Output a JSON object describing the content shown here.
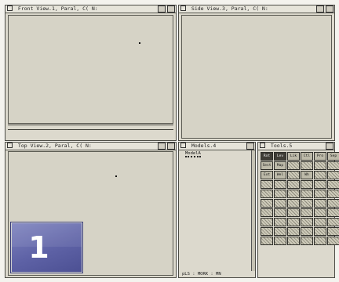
{
  "windows": {
    "front": {
      "title": "Front View.1, Paral, C( N:"
    },
    "side": {
      "title": "Side View.3, Paral, C( N:"
    },
    "top": {
      "title": "Top View.2, Paral, C( N:"
    },
    "models": {
      "title": "Models.4",
      "item": "ModelA"
    },
    "tools": {
      "title": "Tools.5"
    }
  },
  "toolbox": {
    "rows": [
      [
        "Rot",
        "Lev",
        "Lik",
        "Ctl",
        "Pro",
        "Sep"
      ],
      [
        "Sest",
        "Map",
        "",
        "",
        "",
        ""
      ],
      [
        "Ext",
        "Wel",
        "",
        "Wh",
        "",
        ""
      ],
      [
        "",
        "",
        "",
        "",
        "",
        ""
      ],
      [
        "",
        "",
        "",
        "",
        "",
        ""
      ],
      [
        "",
        "",
        "",
        "",
        "",
        ""
      ],
      [
        "",
        "",
        "",
        "",
        "",
        ""
      ],
      [
        "",
        "",
        "",
        "",
        "",
        ""
      ],
      [
        "",
        "",
        "",
        "",
        "",
        ""
      ],
      [
        "",
        "",
        "",
        "",
        "",
        ""
      ]
    ]
  },
  "status": {
    "text": "pLS : MORK : MN"
  },
  "badge": {
    "number": "1",
    "color": "#5e62a6"
  }
}
